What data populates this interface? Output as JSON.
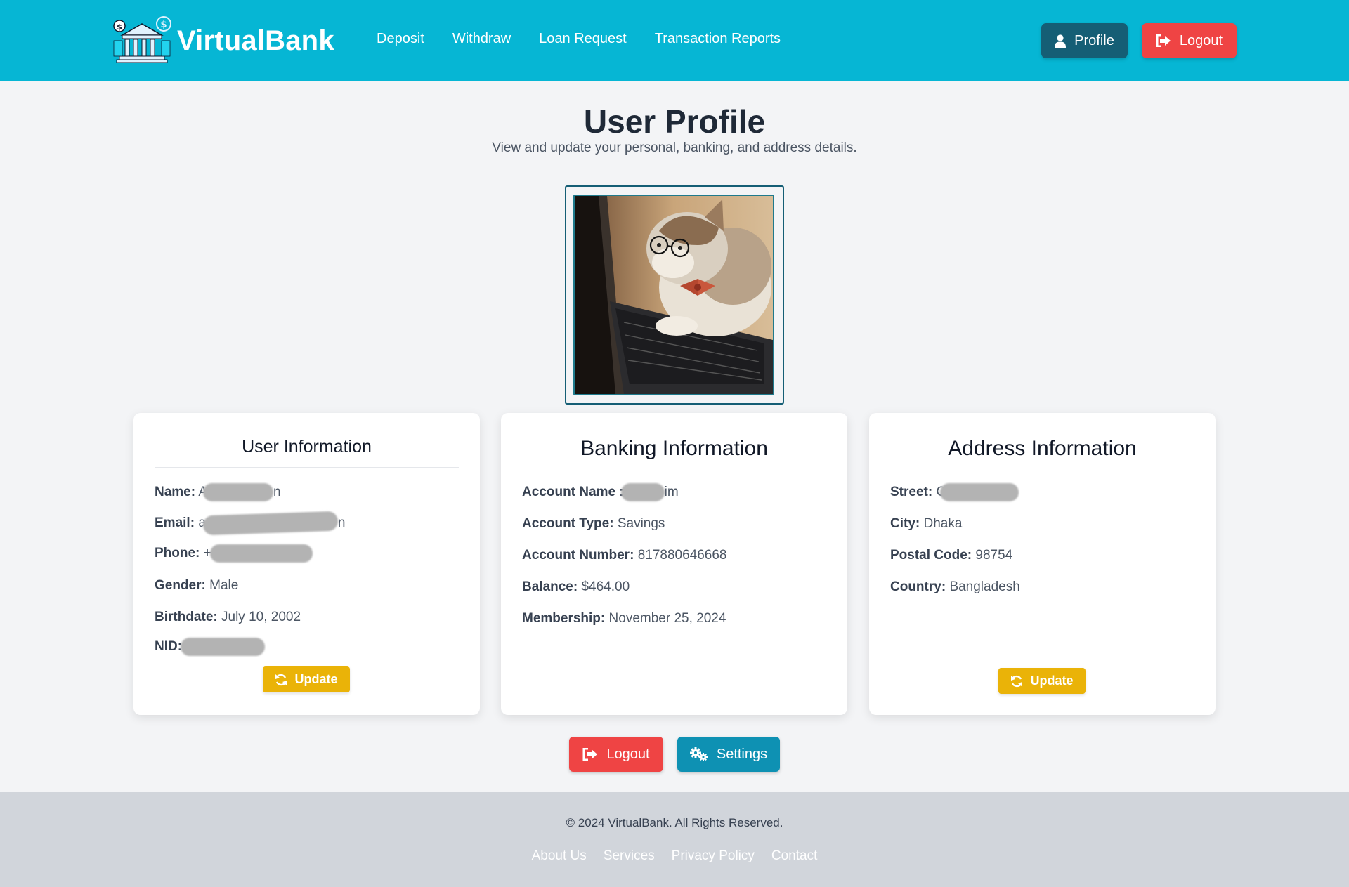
{
  "app": {
    "name": "VirtualBank"
  },
  "nav": {
    "links": [
      "Deposit",
      "Withdraw",
      "Loan Request",
      "Transaction Reports"
    ],
    "profile_label": "Profile",
    "logout_label": "Logout"
  },
  "page": {
    "title": "User Profile",
    "subtitle": "View and update your personal, banking, and address details."
  },
  "user_info": {
    "title": "User Information",
    "name_label": "Name:",
    "name_prefix": "A",
    "name_suffix": "n",
    "email_label": "Email:",
    "email_prefix": "a",
    "email_suffix": "n",
    "phone_label": "Phone:",
    "phone_prefix": "+",
    "gender_label": "Gender:",
    "gender": "Male",
    "birthdate_label": "Birthdate:",
    "birthdate": "July 10, 2002",
    "nid_label": "NID:",
    "update_label": "Update"
  },
  "banking_info": {
    "title": "Banking Information",
    "account_name_label": "Account Name :",
    "account_name_suffix": "im",
    "account_type_label": "Account Type:",
    "account_type": "Savings",
    "account_number_label": "Account Number:",
    "account_number": "817880646668",
    "balance_label": "Balance:",
    "balance": "$464.00",
    "membership_label": "Membership:",
    "membership": "November 25, 2024"
  },
  "address_info": {
    "title": "Address Information",
    "street_label": "Street:",
    "street_prefix": "C",
    "city_label": "City:",
    "city": "Dhaka",
    "postal_label": "Postal Code:",
    "postal": "98754",
    "country_label": "Country:",
    "country": "Bangladesh",
    "update_label": "Update"
  },
  "actions": {
    "logout_label": "Logout",
    "settings_label": "Settings"
  },
  "footer": {
    "copyright": "© 2024 VirtualBank. All Rights Reserved.",
    "links": [
      "About Us",
      "Services",
      "Privacy Policy",
      "Contact"
    ]
  },
  "colors": {
    "header": "#06b6d4",
    "profile_button": "#155e75",
    "logout_button": "#ef4444",
    "update_button": "#eab308",
    "settings_button": "#0e91b3",
    "footer": "#d1d5db"
  },
  "icons": {
    "logo": "bank-building-icon",
    "profile": "user-icon",
    "logout": "sign-out-icon",
    "update": "refresh-icon",
    "settings": "cogs-icon"
  }
}
